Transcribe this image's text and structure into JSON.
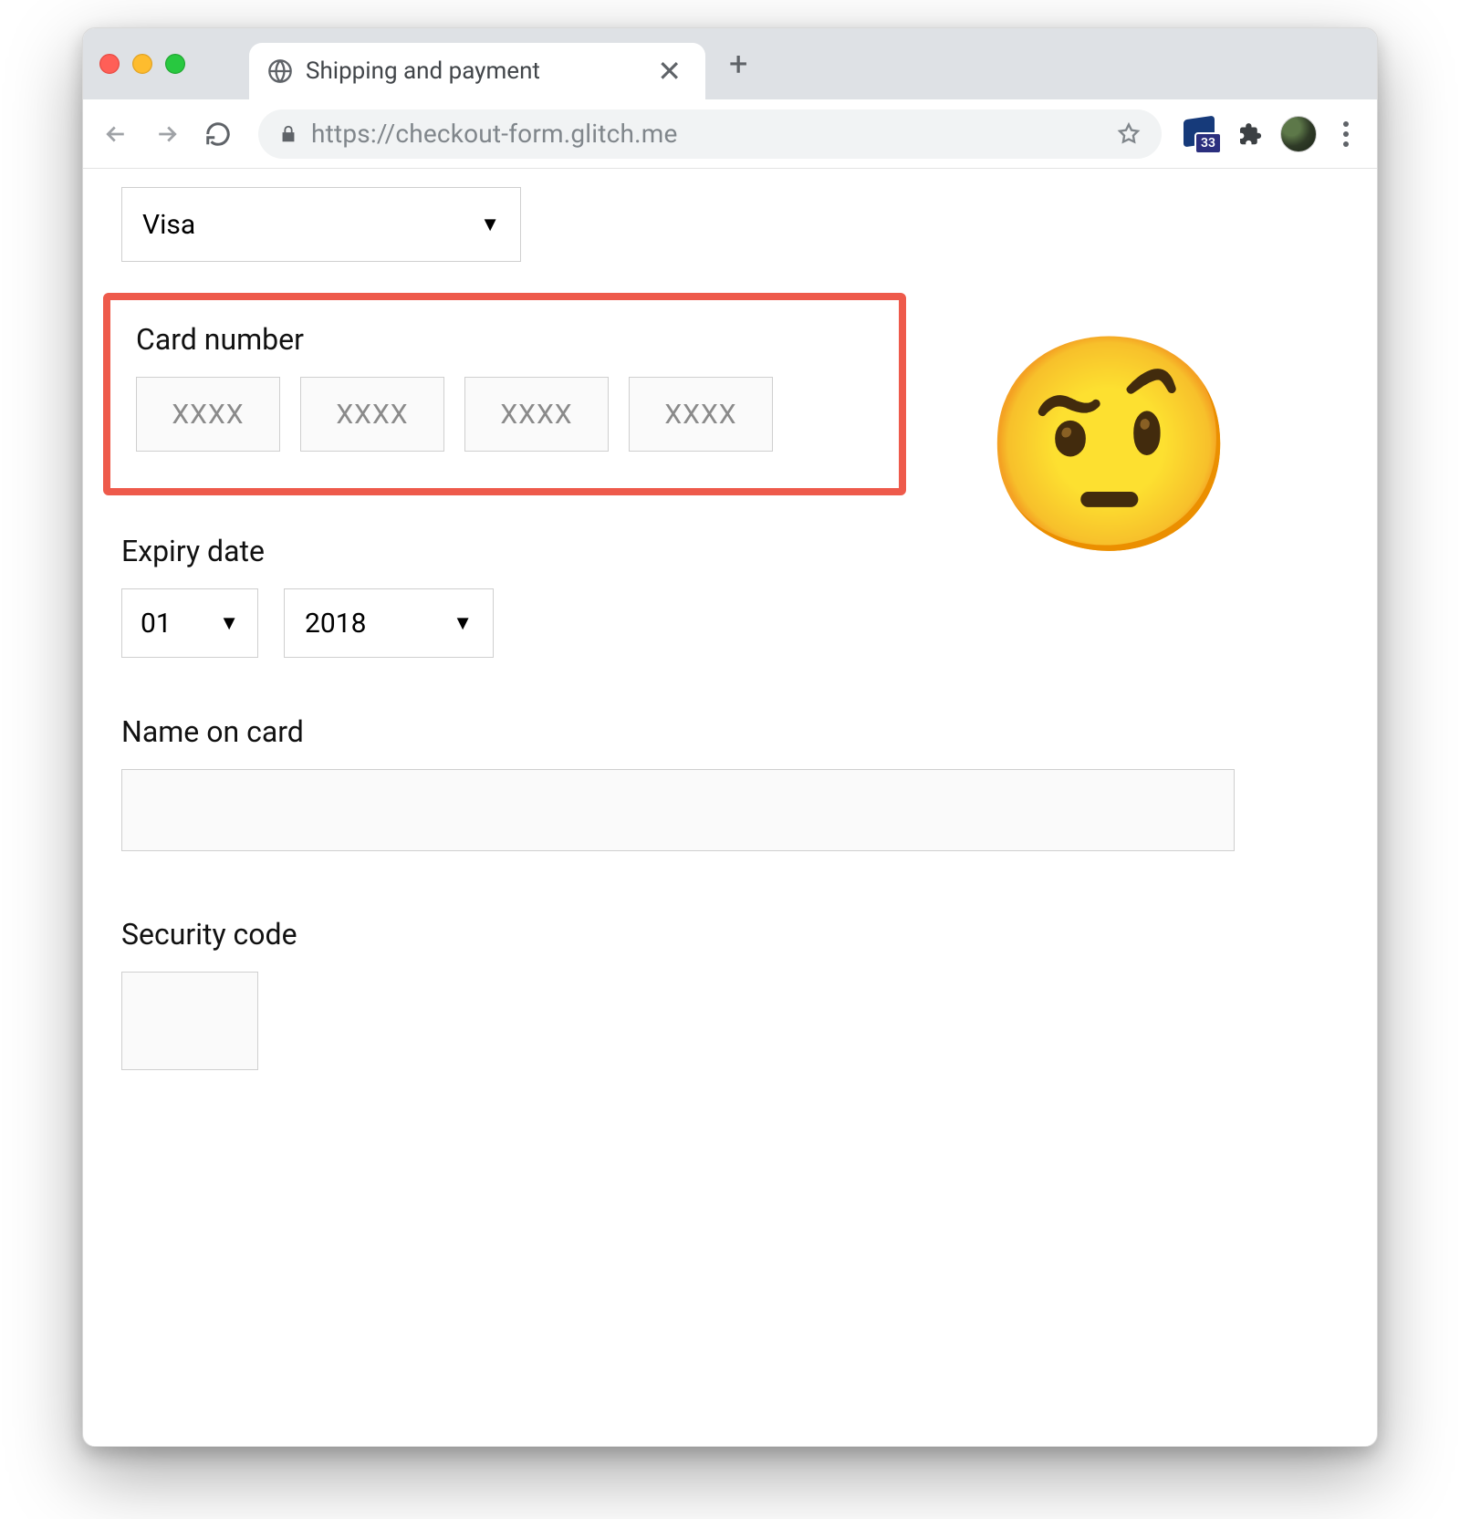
{
  "window": {
    "tab_title": "Shipping and payment",
    "url": "https://checkout-form.glitch.me",
    "extension_badge_count": "33"
  },
  "form": {
    "card_type_value": "Visa",
    "card_number_label": "Card number",
    "card_segment_placeholder": "XXXX",
    "expiry_label": "Expiry date",
    "expiry_month_value": "01",
    "expiry_year_value": "2018",
    "name_label": "Name on card",
    "security_label": "Security code"
  },
  "emoji": "🤨"
}
